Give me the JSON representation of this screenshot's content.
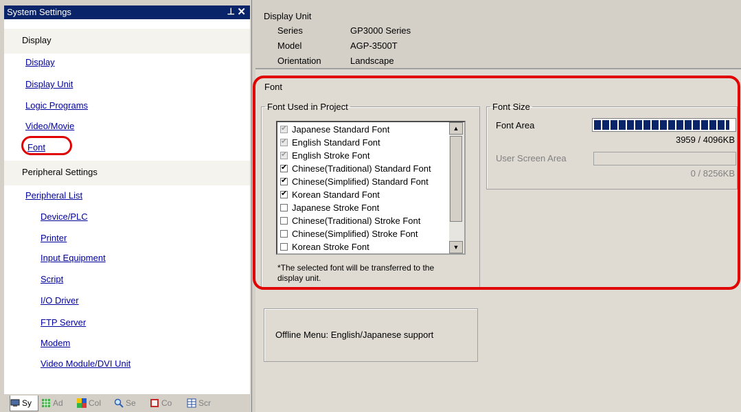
{
  "panel": {
    "title": "System Settings",
    "pin_glyph": "⊥",
    "close_glyph": "✕"
  },
  "sections": [
    {
      "heading": "Display",
      "links": [
        "Display",
        "Display Unit",
        "Logic Programs",
        "Video/Movie",
        "Font"
      ]
    },
    {
      "heading": "Peripheral Settings",
      "links": [
        "Peripheral List",
        "Device/PLC",
        "Printer",
        "Input Equipment",
        "Script",
        "I/O Driver",
        "FTP Server",
        "Modem",
        "Video Module/DVI Unit"
      ]
    }
  ],
  "bottom_tabs": [
    "Sy",
    "Ad",
    "Col",
    "Se",
    "Co",
    "Scr"
  ],
  "display_unit": {
    "title": "Display Unit",
    "series_label": "Series",
    "series_value": "GP3000 Series",
    "model_label": "Model",
    "model_value": "AGP-3500T",
    "orientation_label": "Orientation",
    "orientation_value": "Landscape"
  },
  "font": {
    "title": "Font",
    "used_group": "Font Used in Project",
    "fonts": [
      {
        "name": "Japanese Standard Font",
        "checked": true,
        "disabled": true
      },
      {
        "name": "English Standard Font",
        "checked": true,
        "disabled": true
      },
      {
        "name": "English Stroke Font",
        "checked": true,
        "disabled": true
      },
      {
        "name": "Chinese(Traditional) Standard Font",
        "checked": true,
        "disabled": false
      },
      {
        "name": "Chinese(Simplified) Standard Font",
        "checked": true,
        "disabled": false
      },
      {
        "name": "Korean Standard Font",
        "checked": true,
        "disabled": false
      },
      {
        "name": "Japanese Stroke Font",
        "checked": false,
        "disabled": false
      },
      {
        "name": "Chinese(Traditional) Stroke Font",
        "checked": false,
        "disabled": false
      },
      {
        "name": "Chinese(Simplified) Stroke Font",
        "checked": false,
        "disabled": false
      },
      {
        "name": "Korean Stroke Font",
        "checked": false,
        "disabled": false
      }
    ],
    "note_line1": "*The selected font will be transferred to the",
    "note_line2": "display unit.",
    "size_group": "Font Size",
    "font_area_label": "Font Area",
    "font_area_value": "3959 / 4096KB",
    "font_area_fraction": 0.9666,
    "user_area_label": "User Screen Area",
    "user_area_value": "0 / 8256KB",
    "user_area_fraction": 0
  },
  "offline": {
    "text": "Offline Menu: English/Japanese support"
  },
  "colors": {
    "title_bar": "#0a246a",
    "link": "#00009c",
    "highlight": "#e00000"
  }
}
